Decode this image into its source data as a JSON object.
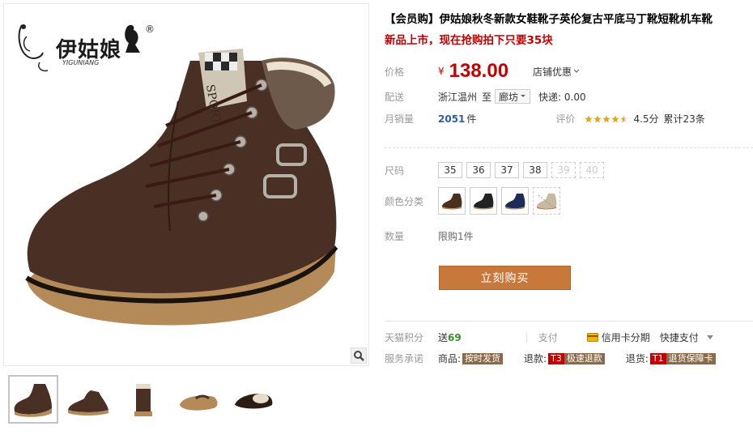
{
  "gallery": {
    "logo_text": "伊姑娘",
    "logo_sub": "YIGUNIANG",
    "logo_reg": "®",
    "zoom_icon": "magnifier-icon",
    "thumbnails": [
      "boot-side-dark",
      "boot-pair",
      "boot-back",
      "boot-sole",
      "boot-top"
    ]
  },
  "product": {
    "title": "【会员购】伊姑娘秋冬新款女鞋靴子英伦复古平底马丁靴短靴机车靴",
    "subtitle": "新品上市，现在抢购拍下只要35块"
  },
  "price": {
    "label": "价格",
    "currency": "¥",
    "value": "138.00",
    "promo": "店铺优惠"
  },
  "shipping": {
    "label": "配送",
    "from": "浙江温州",
    "to_word": "至",
    "destination": "廊坊",
    "fee": "快递: 0.00"
  },
  "sales": {
    "label": "月销量",
    "count": "2051",
    "unit": "件",
    "rating_label": "评价",
    "rating": "4.5分",
    "review_total": "累计23条"
  },
  "sizes": {
    "label": "尺码",
    "options": [
      {
        "value": "35",
        "available": true
      },
      {
        "value": "36",
        "available": true
      },
      {
        "value": "37",
        "available": true
      },
      {
        "value": "38",
        "available": true
      },
      {
        "value": "39",
        "available": false
      },
      {
        "value": "40",
        "available": false
      }
    ]
  },
  "colors": {
    "label": "颜色分类",
    "options": [
      {
        "name": "brown",
        "color": "#4a3020",
        "available": true
      },
      {
        "name": "black",
        "color": "#222222",
        "available": true
      },
      {
        "name": "blue",
        "color": "#1e2b5a",
        "available": true
      },
      {
        "name": "beige",
        "color": "#c9b9a0",
        "available": false
      }
    ]
  },
  "quantity": {
    "label": "数量",
    "limit": "限购1件"
  },
  "buy_button": "立刻购买",
  "footer": {
    "points_label": "天猫积分",
    "points_prefix": "送",
    "points_value": "69",
    "pay_label": "支付",
    "credit_label": "信用卡分期",
    "fast_pay": "快捷支付",
    "service_label": "服务承诺",
    "service_items": [
      {
        "prefix": "商品:",
        "tag": "按时发货",
        "tag_color": "#8a6a4a"
      },
      {
        "prefix": "退款:",
        "badge": "T3",
        "tag": "极速退款",
        "tag_color": "#8a6a4a"
      },
      {
        "prefix": "退货:",
        "badge": "T1",
        "tag": "退货保障卡",
        "tag_color": "#8a6a4a"
      }
    ]
  }
}
